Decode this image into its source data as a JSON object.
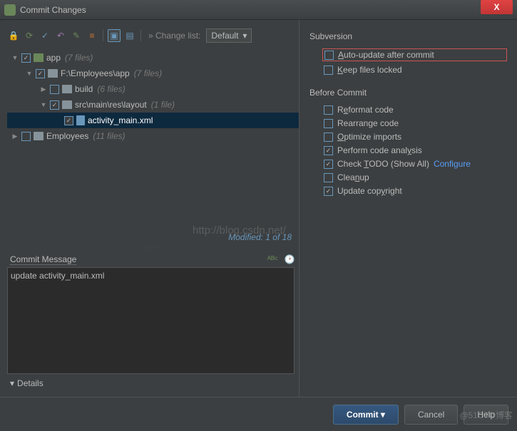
{
  "window": {
    "title": "Commit Changes"
  },
  "toolbar": {
    "changelist_label": "» Change list:",
    "changelist_value": "Default"
  },
  "tree": {
    "nodes": [
      {
        "indent": 0,
        "expanded": true,
        "checked": true,
        "icon": "app-folder",
        "label": "app",
        "count": "(7 files)"
      },
      {
        "indent": 1,
        "expanded": true,
        "checked": true,
        "icon": "folder",
        "label": "F:\\Employees\\app",
        "count": "(7 files)"
      },
      {
        "indent": 2,
        "expanded": false,
        "checked": false,
        "icon": "folder",
        "label": "build",
        "count": "(6 files)"
      },
      {
        "indent": 2,
        "expanded": true,
        "checked": true,
        "icon": "folder",
        "label": "src\\main\\res\\layout",
        "count": "(1 file)"
      },
      {
        "indent": 3,
        "expanded": null,
        "checked": true,
        "icon": "file",
        "label": "activity_main.xml",
        "count": "",
        "selected": true
      },
      {
        "indent": 0,
        "expanded": false,
        "checked": false,
        "icon": "folder",
        "label": "Employees",
        "count": "(11 files)"
      }
    ],
    "modified_status": "Modified: 1 of 18"
  },
  "commit_message": {
    "label": "Commit Message",
    "value": "update activity_main.xml"
  },
  "details": {
    "label": "Details"
  },
  "subversion": {
    "title": "Subversion",
    "options": [
      {
        "key": "auto_update",
        "label_pre": "",
        "u": "A",
        "label_post": "uto-update after commit",
        "checked": false,
        "highlight": true
      },
      {
        "key": "keep_files",
        "label_pre": "",
        "u": "K",
        "label_post": "eep files locked",
        "checked": false
      }
    ]
  },
  "before_commit": {
    "title": "Before Commit",
    "options": [
      {
        "key": "reformat",
        "label_pre": "R",
        "u": "e",
        "label_post": "format code",
        "checked": false
      },
      {
        "key": "rearrange",
        "label_pre": "Rearran",
        "u": "g",
        "label_post": "e code",
        "checked": false
      },
      {
        "key": "optimize",
        "label_pre": "",
        "u": "O",
        "label_post": "ptimize imports",
        "checked": false
      },
      {
        "key": "analysis",
        "label_pre": "Perform code anal",
        "u": "y",
        "label_post": "sis",
        "checked": true
      },
      {
        "key": "todo",
        "label_pre": "Check ",
        "u": "T",
        "label_post": "ODO (Show All)",
        "checked": true,
        "link": "Configure"
      },
      {
        "key": "cleanup",
        "label_pre": "Clea",
        "u": "n",
        "label_post": "up",
        "checked": false
      },
      {
        "key": "copyright",
        "label_pre": "Update cop",
        "u": "y",
        "label_post": "right",
        "checked": true
      }
    ]
  },
  "footer": {
    "commit": "Commit",
    "cancel": "Cancel",
    "help": "Help"
  },
  "watermark": "http://blog.csdn.net/",
  "watermark2": "@51CTO博客"
}
